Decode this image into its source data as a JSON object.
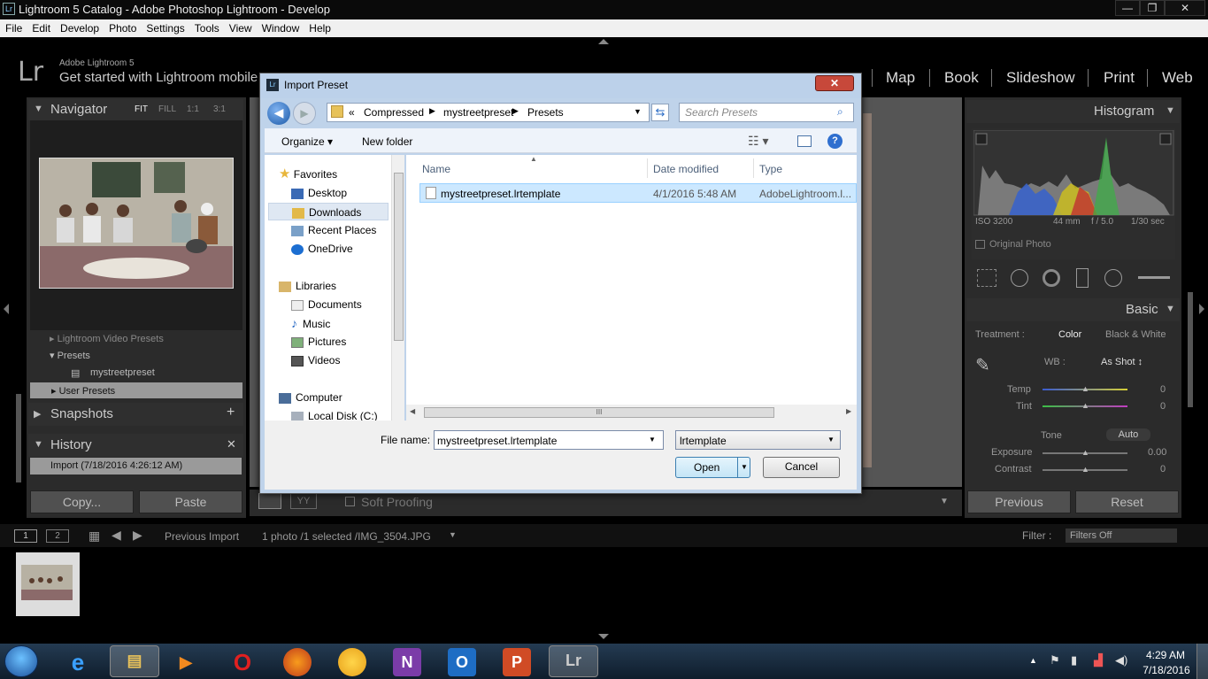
{
  "window": {
    "title": "Lightroom 5 Catalog - Adobe Photoshop Lightroom - Develop",
    "icon_label": "Lr",
    "controls": {
      "minimize": "—",
      "maximize": "❐",
      "close": "✕"
    }
  },
  "menu": [
    "File",
    "Edit",
    "Develop",
    "Photo",
    "Settings",
    "Tools",
    "View",
    "Window",
    "Help"
  ],
  "lr_header": {
    "logo": "Lr",
    "product": "Adobe Lightroom 5",
    "tagline": "Get started with Lightroom mobile",
    "modules": [
      "Map",
      "Book",
      "Slideshow",
      "Print",
      "Web"
    ]
  },
  "left_panel": {
    "navigator": {
      "title": "Navigator",
      "zoom": [
        "FIT",
        "FILL",
        "1:1",
        "3:1"
      ]
    },
    "presets": {
      "items": [
        "Lightroom Video Presets",
        "Presets",
        "mystreetpreset",
        "User Presets"
      ]
    },
    "snapshots": {
      "title": "Snapshots",
      "add": "+"
    },
    "history": {
      "title": "History",
      "close": "✕",
      "items": [
        "Import (7/18/2016 4:26:12 AM)"
      ]
    },
    "copy_button": "Copy...",
    "paste_button": "Paste"
  },
  "right_panel": {
    "histogram": {
      "title": "Histogram",
      "iso": "ISO 3200",
      "focal": "44 mm",
      "aperture": "f / 5.0",
      "shutter": "1/30 sec",
      "original_photo": "Original Photo"
    },
    "basic": {
      "title": "Basic",
      "treatment_label": "Treatment :",
      "treatment_color": "Color",
      "treatment_bw": "Black & White",
      "wb_label": "WB :",
      "wb_value": "As Shot ↕",
      "temp_label": "Temp",
      "temp_value": "0",
      "tint_label": "Tint",
      "tint_value": "0",
      "tone_label": "Tone",
      "auto_label": "Auto",
      "exposure_label": "Exposure",
      "exposure_value": "0.00",
      "contrast_label": "Contrast",
      "contrast_value": "0"
    },
    "previous_button": "Previous",
    "reset_button": "Reset"
  },
  "center_toolbar": {
    "soft_proofing": "Soft Proofing",
    "yy": "YY"
  },
  "filmstrip_bar": {
    "view1": "1",
    "view2": "2",
    "source": "Previous Import",
    "info": "1 photo /1 selected /IMG_3504.JPG",
    "filter_label": "Filter :",
    "filter_value": "Filters Off"
  },
  "dialog": {
    "title": "Import Preset",
    "close": "✕",
    "breadcrumb": [
      "«",
      "Compressed",
      "mystreetpreset",
      "Presets"
    ],
    "search_placeholder": "Search Presets",
    "organize": "Organize ▾",
    "new_folder": "New folder",
    "nav": {
      "favorites": "Favorites",
      "desktop": "Desktop",
      "downloads": "Downloads",
      "recent": "Recent Places",
      "onedrive": "OneDrive",
      "libraries": "Libraries",
      "documents": "Documents",
      "music": "Music",
      "pictures": "Pictures",
      "videos": "Videos",
      "computer": "Computer",
      "localdisk": "Local Disk (C:)"
    },
    "columns": {
      "name": "Name",
      "date": "Date modified",
      "type": "Type"
    },
    "files": [
      {
        "name": "mystreetpreset.lrtemplate",
        "date": "4/1/2016 5:48 AM",
        "type": "AdobeLightroom.l..."
      }
    ],
    "filename_label": "File name:",
    "filename_value": "mystreetpreset.lrtemplate",
    "filetype_value": "lrtemplate",
    "open_button": "Open",
    "cancel_button": "Cancel",
    "hscroll_grip": "III"
  },
  "taskbar": {
    "time": "4:29 AM",
    "date": "7/18/2016"
  },
  "colors": {
    "lr_bg": "#2b2b2b",
    "dialog_frame": "#bfd3ea",
    "selection": "#cce8ff",
    "close_red": "#c7483a"
  }
}
